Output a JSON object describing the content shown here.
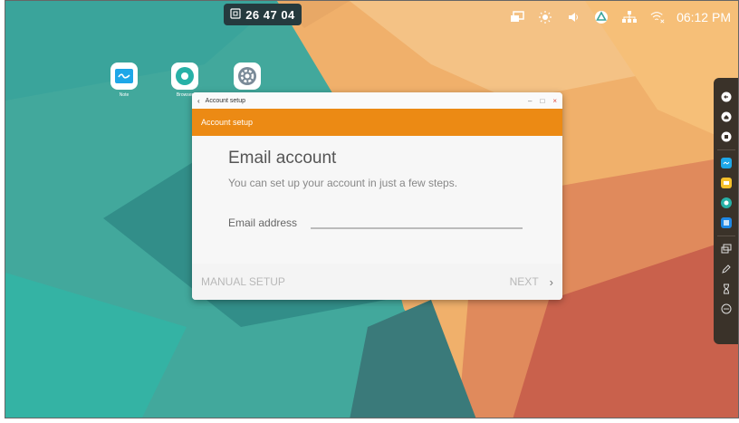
{
  "topbar": {
    "screen_code": "26 47 04",
    "clock": "06:12 PM"
  },
  "desktop": {
    "apps": [
      {
        "label": "Note",
        "icon": "note-icon",
        "color": "#1ea7e8"
      },
      {
        "label": "Browser",
        "icon": "browser-icon",
        "color": "#27b1a7"
      },
      {
        "label": "",
        "icon": "settings-icon",
        "color": "#7a8a98"
      }
    ]
  },
  "dialog": {
    "window_title": "Account setup",
    "action_title": "Account setup",
    "heading": "Email account",
    "subtext": "You can set up your account in just a few steps.",
    "email_label": "Email address",
    "email_value": "",
    "manual_setup_label": "MANUAL SETUP",
    "next_label": "NEXT"
  },
  "colors": {
    "accent": "#ec8a14",
    "dock_bg": "#3a3229",
    "code_pill_bg": "#253a3e"
  }
}
